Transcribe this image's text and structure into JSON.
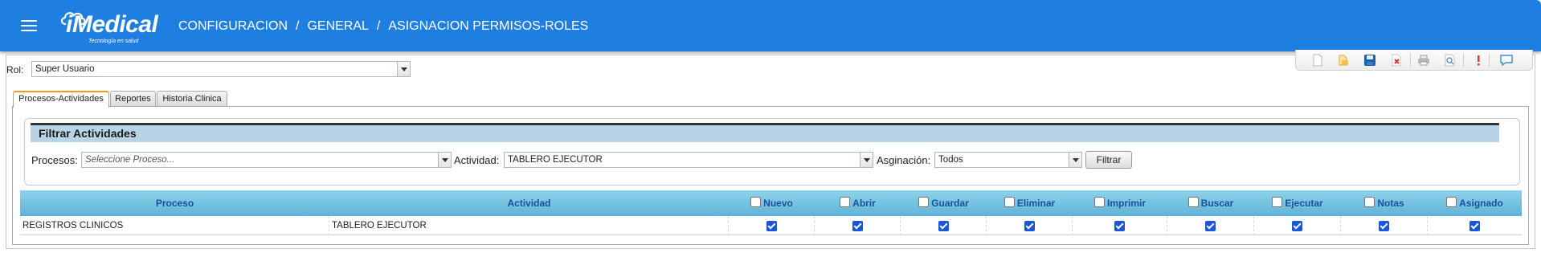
{
  "header": {
    "logo_text": "iMedical",
    "logo_tagline": "Tecnología en salud",
    "breadcrumb": [
      "CONFIGURACION",
      "GENERAL",
      "ASIGNACION PERMISOS-ROLES"
    ],
    "separator": "/",
    "bar_color": "#1f7fe0"
  },
  "rol": {
    "label": "Rol:",
    "value": "Super Usuario"
  },
  "toolbar": {
    "icons": [
      "new-document-icon",
      "open-folder-icon",
      "save-icon",
      "delete-icon",
      "print-icon",
      "preview-icon",
      "help-icon",
      "chat-icon"
    ]
  },
  "tabs": [
    "Procesos-Actividades",
    "Reportes",
    "Historia Clinica"
  ],
  "filter": {
    "title": "Filtrar Actividades",
    "procesos_label": "Procesos:",
    "procesos_placeholder": "Seleccione Proceso...",
    "actividad_label": "Actividad:",
    "actividad_value": "TABLERO EJECUTOR",
    "asignacion_label": "Asginación:",
    "asignacion_value": "Todos",
    "button": "Filtrar"
  },
  "grid": {
    "columns": [
      "Proceso",
      "Actividad",
      "Nuevo",
      "Abrir",
      "Guardar",
      "Eliminar",
      "Imprimir",
      "Buscar",
      "Ejecutar",
      "Notas",
      "Asignado"
    ],
    "rows": [
      {
        "proceso": "REGISTROS CLINICOS",
        "actividad": "TABLERO EJECUTOR",
        "checks": [
          true,
          true,
          true,
          true,
          true,
          true,
          true,
          true,
          true
        ]
      }
    ]
  },
  "colors": {
    "accent": "#1f7fe0",
    "grid_header": "#5fb3d6",
    "filter_title": "#b9d3e6",
    "active_tab": "#f29a1a",
    "checkbox": "#1a56d8"
  }
}
